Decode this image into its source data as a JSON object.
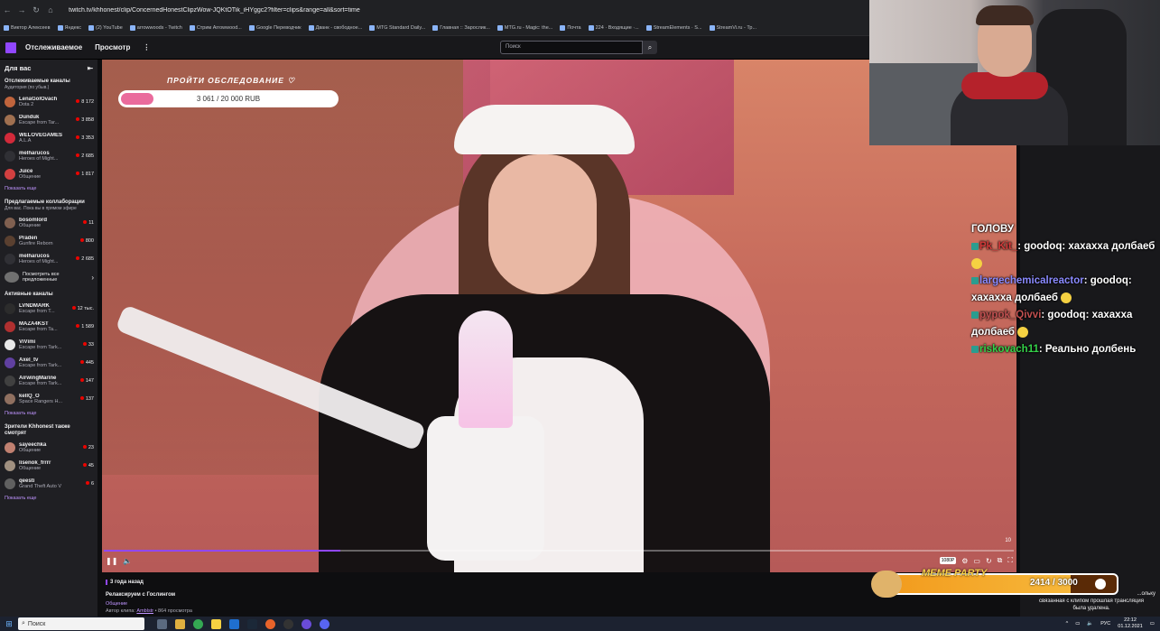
{
  "browser": {
    "url": "twitch.tv/khhonest/clip/ConcernedHonestClipzWow-JQKtOTik_iHYggc2?filter=clips&range=all&sort=time",
    "bookmarks": [
      "Виктор Алексеев",
      "Яндекс",
      "(2) YouTube",
      "arrowwoods - Twitch",
      "Стрим Arrowwood...",
      "Google Переводчик",
      "Дванк - свободное...",
      "MTG Standard Daily...",
      "Главная :: Зарослик...",
      "MTG.ru - Magic: the...",
      "Почта",
      "224 · Входящие ·...",
      "StreamElements · S...",
      "StreamVi.ru - Тр..."
    ]
  },
  "header": {
    "nav_following": "Отслеживаемое",
    "nav_browse": "Просмотр",
    "more": "⋮",
    "search_placeholder": "Поиск"
  },
  "sidebar": {
    "title": "Для вас",
    "followed": {
      "title": "Отслеживаемые каналы",
      "subtitle": "Аудитория (по убыв.)",
      "channels": [
        {
          "name": "LenaGolOvach",
          "game": "Dota 2",
          "viewers": "8 172",
          "color": "#c0643c"
        },
        {
          "name": "Dunduk",
          "game": "Escape from Tar...",
          "viewers": "3 858",
          "color": "#a07050"
        },
        {
          "name": "WELOVEGAMES",
          "game": "A.L.A",
          "viewers": "3 353",
          "color": "#d22a3a"
        },
        {
          "name": "melharucos",
          "game": "Heroes of Might...",
          "viewers": "2 685",
          "color": "#303035"
        },
        {
          "name": "Juice",
          "game": "Общение",
          "viewers": "1 817",
          "color": "#d24040"
        }
      ],
      "show_more": "Показать еще"
    },
    "collabs": {
      "title": "Предлагаемые коллаборации",
      "subtitle": "Для вас. Пока вы в прямом эфире",
      "channels": [
        {
          "name": "bosomlord",
          "game": "Общение",
          "viewers": "11",
          "color": "#806050"
        },
        {
          "name": "Praden",
          "game": "Gunfire Reborn",
          "viewers": "800",
          "color": "#5a4030"
        },
        {
          "name": "melharucos",
          "game": "Heroes of Might...",
          "viewers": "2 685",
          "color": "#303035"
        }
      ],
      "see_all_line1": "Посмотреть все",
      "see_all_line2": "предложенные"
    },
    "active": {
      "title": "Активные каналы",
      "channels": [
        {
          "name": "LVNDMARK",
          "game": "Escape from T...",
          "viewers": "12 тыс.",
          "color": "#2c2c2c"
        },
        {
          "name": "MAZA4KST",
          "game": "Escape from Ta...",
          "viewers": "1 589",
          "color": "#b03030"
        },
        {
          "name": "ViVimi",
          "game": "Escape from Tark...",
          "viewers": "33",
          "color": "#e8e8e8"
        },
        {
          "name": "Axel_tv",
          "game": "Escape from Tark...",
          "viewers": "445",
          "color": "#6040a0"
        },
        {
          "name": "AirwingMarine",
          "game": "Escape from Tark...",
          "viewers": "147",
          "color": "#404040"
        },
        {
          "name": "kellQ_O",
          "game": "Space Rangers H...",
          "viewers": "137",
          "color": "#907060"
        }
      ],
      "show_more": "Показать еще"
    },
    "viewers_also": {
      "title_line1": "Зрители Khhonest также",
      "title_line2": "смотрят",
      "channels": [
        {
          "name": "sayeechka",
          "game": "Общение",
          "viewers": "23",
          "color": "#c08070"
        },
        {
          "name": "lisenok_frrrr",
          "game": "Общение",
          "viewers": "45",
          "color": "#a09080"
        },
        {
          "name": "qeesti",
          "game": "Grand Theft Auto V",
          "viewers": "6",
          "color": "#606060"
        }
      ],
      "show_more": "Показать еще"
    }
  },
  "video_overlay": {
    "title": "ПРОЙТИ ОБСЛЕДОВАНИЕ ♡",
    "amount": "3 061 / 20 000 RUB",
    "progress": 0.153
  },
  "player": {
    "progress": 0.26,
    "time_right": "10",
    "quality": "1080P"
  },
  "clip": {
    "ago": "3 года назад",
    "title": "Релаксируем с Гослингом",
    "category": "Общение",
    "author_prefix": "Автор клипа:",
    "author": "Amblstr",
    "views": "• 864 просмотра"
  },
  "chat": {
    "messages": [
      {
        "user": "",
        "text": "ГОЛОВУ",
        "color": "#ffffff"
      },
      {
        "user": "Pk_Kit_",
        "text": ": goodoq: хахахха долбаеб",
        "color": "#d43a3a"
      },
      {
        "user": "largechemicalreactor",
        "text": ": goodoq: хахахха долбаеб",
        "color": "#8a8aff"
      },
      {
        "user": "pypok_Qivvi",
        "text": ": goodoq: хахахха долбаеб",
        "color": "#c25050"
      },
      {
        "user": "riskovach11",
        "text": ": Реально долбень",
        "color": "#35d24a"
      }
    ]
  },
  "meme_party": {
    "title": "MEME PARTY",
    "count": "2414 / 3000",
    "progress": 0.805
  },
  "deleted_note": {
    "line1": "...ольку",
    "line2": "связанная с клипом прошлая трансляция",
    "line3": "была удалена."
  },
  "taskbar": {
    "search": "Поиск",
    "lang": "РУС",
    "time": "22:12",
    "date": "01.12.2021"
  }
}
